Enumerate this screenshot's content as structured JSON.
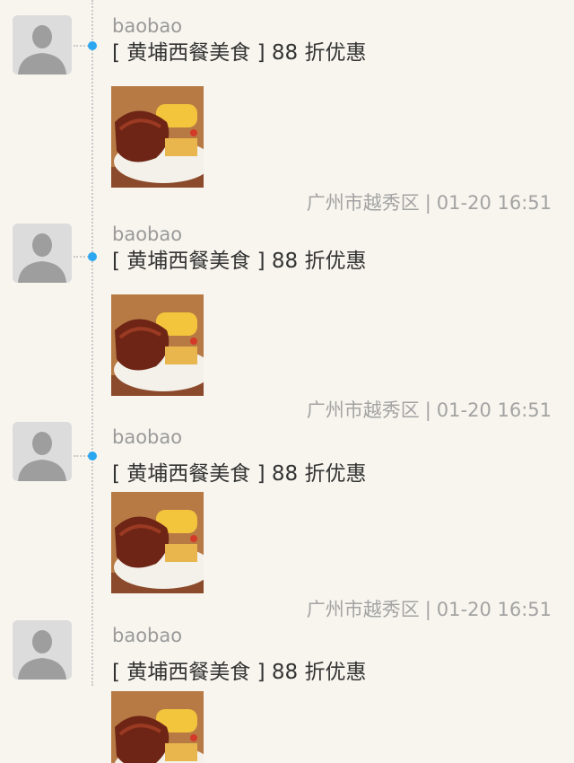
{
  "posts": [
    {
      "username": "baobao",
      "message": "[ 黄埔西餐美食 ] 88 折优惠",
      "location": "广州市越秀区",
      "separator": "|",
      "time": "01-20 16:51"
    },
    {
      "username": "baobao",
      "message": "[ 黄埔西餐美食 ] 88 折优惠",
      "location": "广州市越秀区",
      "separator": "|",
      "time": "01-20 16:51"
    },
    {
      "username": "baobao",
      "message": "[ 黄埔西餐美食 ] 88 折优惠",
      "location": "广州市越秀区",
      "separator": "|",
      "time": "01-20 16:51"
    },
    {
      "username": "baobao",
      "message": "[ 黄埔西餐美食 ] 88 折优惠"
    }
  ],
  "colors": {
    "accent_dot": "#2aa7f0",
    "background": "#f7f5ee",
    "username": "#9a9a9a",
    "meta": "#a3a3a3"
  },
  "icons": {
    "avatar": "default-user-avatar-icon",
    "photo": "ribs-food-photo"
  }
}
